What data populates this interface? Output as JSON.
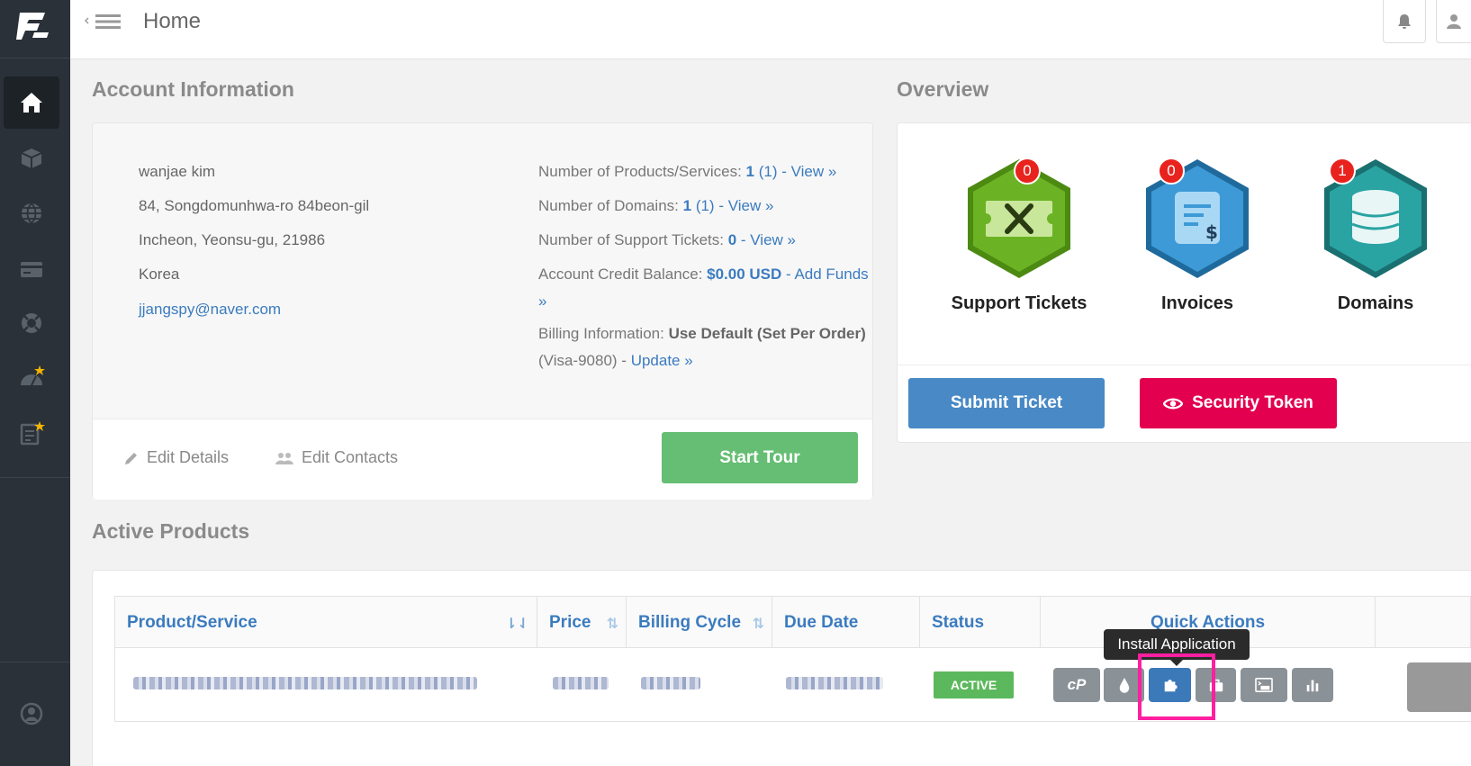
{
  "topbar": {
    "title": "Home"
  },
  "sections": {
    "account": "Account Information",
    "overview": "Overview",
    "products": "Active Products"
  },
  "account": {
    "name": "wanjae kim",
    "address1": "84, Songdomunhwa-ro 84beon-gil",
    "address2": "Incheon, Yeonsu-gu, 21986",
    "country": "Korea",
    "email": "jjangspy@naver.com",
    "products_label": "Number of Products/Services: ",
    "products_value": "1",
    "products_extra": " (1) - View »",
    "domains_label": "Number of Domains: ",
    "domains_value": "1",
    "domains_extra": " (1) - View »",
    "tickets_label": "Number of Support Tickets: ",
    "tickets_value": "0",
    "tickets_extra": " - View »",
    "credit_label": "Account Credit Balance: ",
    "credit_value": "$0.00 USD",
    "credit_extra": " - Add Funds",
    "credit_extra2": "»",
    "billing_label": "Billing Information: ",
    "billing_value": "Use Default (Set Per Order)",
    "billing_card": "(Visa-9080) - ",
    "billing_update": "Update »",
    "edit_details": "Edit Details",
    "edit_contacts": "Edit Contacts",
    "start_tour": "Start Tour"
  },
  "overview": {
    "items": [
      {
        "label": "Support Tickets",
        "count": "0",
        "color": "#6bb324"
      },
      {
        "label": "Invoices",
        "count": "0",
        "color": "#3d9ad6"
      },
      {
        "label": "Domains",
        "count": "1",
        "color": "#2aa3a3"
      }
    ],
    "submit_ticket": "Submit Ticket",
    "security_token": "Security Token"
  },
  "products": {
    "columns": [
      "Product/Service",
      "Price",
      "Billing Cycle",
      "Due Date",
      "Status",
      "Quick Actions"
    ],
    "status": "ACTIVE",
    "tooltip": "Install Application",
    "cpanel_label": "cP"
  }
}
